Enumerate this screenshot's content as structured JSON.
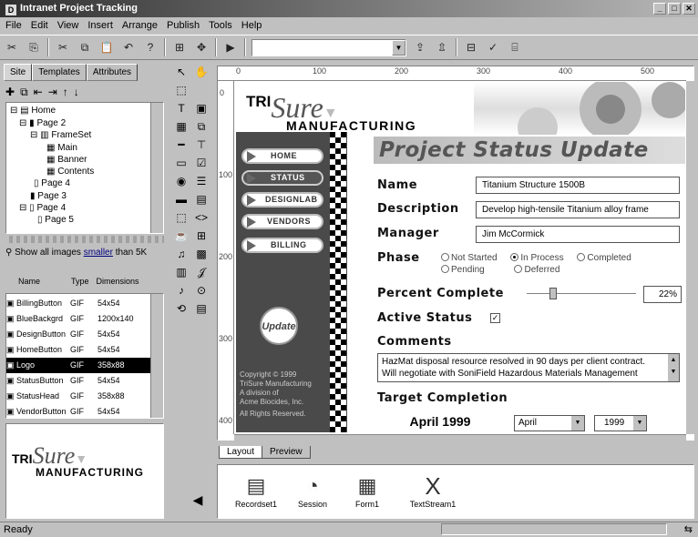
{
  "window": {
    "title": "Intranet Project Tracking"
  },
  "menu": [
    "File",
    "Edit",
    "View",
    "Insert",
    "Arrange",
    "Publish",
    "Tools",
    "Help"
  ],
  "left_tabs": [
    "Site",
    "Templates",
    "Attributes"
  ],
  "tree": [
    {
      "label": "Home"
    },
    {
      "label": "Page 2"
    },
    {
      "label": "FrameSet"
    },
    {
      "label": "Main"
    },
    {
      "label": "Banner"
    },
    {
      "label": "Contents"
    },
    {
      "label": "Page 4"
    },
    {
      "label": "Page 3"
    },
    {
      "label": "Page 4"
    },
    {
      "label": "Page 5"
    }
  ],
  "filter": {
    "prefix": "Show all images",
    "link": "smaller",
    "suffix": "than 5K"
  },
  "file_columns": [
    "Name",
    "Type",
    "Dimensions"
  ],
  "files": [
    {
      "name": "BillingButton",
      "type": "GIF",
      "dim": "54x54"
    },
    {
      "name": "BlueBackgrd",
      "type": "GIF",
      "dim": "1200x140"
    },
    {
      "name": "DesignButton",
      "type": "GIF",
      "dim": "54x54"
    },
    {
      "name": "HomeButton",
      "type": "GIF",
      "dim": "54x54"
    },
    {
      "name": "Logo",
      "type": "GIF",
      "dim": "358x88"
    },
    {
      "name": "StatusButton",
      "type": "GIF",
      "dim": "54x54"
    },
    {
      "name": "StatusHead",
      "type": "GIF",
      "dim": "358x88"
    },
    {
      "name": "VendorButton",
      "type": "GIF",
      "dim": "54x54"
    }
  ],
  "preview": {
    "tri": "TRI",
    "sure": "Sure",
    "manufacturing": "MANUFACTURING"
  },
  "ruler_h": [
    "0",
    "100",
    "200",
    "300",
    "400",
    "500"
  ],
  "ruler_v": [
    "0",
    "100",
    "200",
    "300",
    "400"
  ],
  "logo": {
    "tri": "TRI",
    "sure": "Sure",
    "manufacturing": "MANUFACTURING"
  },
  "nav": [
    "HOME",
    "STATUS",
    "DESIGNLAB",
    "VENDORS",
    "BILLING"
  ],
  "update_badge": "Update",
  "copyright": [
    "Copyright © 1999",
    "TriSure Manufacturing",
    "A division of",
    "Acme Biocides, Inc.",
    "All Rights Reserved."
  ],
  "form": {
    "heading": "Project Status Update",
    "name_label": "Name",
    "name_value": "Titanium Structure 1500B",
    "desc_label": "Description",
    "desc_value": "Develop high-tensile Titanium alloy frame",
    "manager_label": "Manager",
    "manager_value": "Jim McCormick",
    "phase_label": "Phase",
    "phase_options": [
      "Not Started",
      "In Process",
      "Completed",
      "Pending",
      "Deferred"
    ],
    "phase_selected": "In Process",
    "percent_label": "Percent Complete",
    "percent_value": "22%",
    "percent_fraction": 0.22,
    "active_label": "Active Status",
    "active_checked": true,
    "comments_label": "Comments",
    "comments_lines": [
      "HazMat disposal resource resolved in 90 days per client contract.",
      "Will negotiate with SoniField Hazardous Materials Management"
    ],
    "target_label": "Target Completion",
    "target_value": "April 1999",
    "month_value": "April",
    "year_value": "1999"
  },
  "view_tabs": [
    "Layout",
    "Preview"
  ],
  "objects": [
    {
      "label": "Recordset1",
      "icon": "recordset-icon"
    },
    {
      "label": "Session",
      "icon": "asp-session-icon"
    },
    {
      "label": "Form1",
      "icon": "form-icon"
    },
    {
      "label": "TextStream1",
      "icon": "textstream-icon"
    }
  ],
  "status": "Ready"
}
